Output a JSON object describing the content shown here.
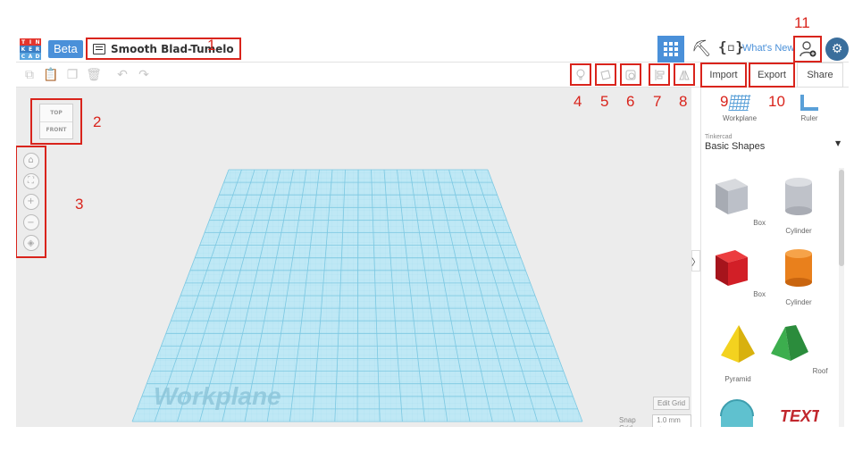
{
  "header": {
    "logo_letters": [
      "T",
      "I",
      "N",
      "K",
      "E",
      "R",
      "C",
      "A",
      "D"
    ],
    "logo_colors": [
      "#e3352d",
      "#e3352d",
      "#e3352d",
      "#3a7ec4",
      "#3a7ec4",
      "#3a7ec4",
      "#59a5e0",
      "#59a5e0",
      "#59a5e0"
    ],
    "beta_label": "Beta",
    "design_title": "Smooth Blad-Tumelo",
    "whats_new": "What's New"
  },
  "toolbar": {
    "import_label": "Import",
    "export_label": "Export",
    "share_label": "Share"
  },
  "viewcube": {
    "top_label": "TOP",
    "front_label": "FRONT"
  },
  "workplane_label": "Workplane",
  "grid": {
    "edit_grid_label": "Edit Grid",
    "snap_grid_label": "Snap Grid",
    "snap_grid_value": "1.0 mm ▲"
  },
  "sidebar": {
    "workplane_tool": "Workplane",
    "ruler_tool": "Ruler",
    "library_label": "Tinkercad",
    "category": "Basic Shapes",
    "shapes": [
      {
        "label": "Box",
        "color": "#b9bcc4"
      },
      {
        "label": "Cylinder",
        "color": "#c7cad1"
      },
      {
        "label": "Box",
        "color": "#d4202a"
      },
      {
        "label": "Cylinder",
        "color": "#e87b1a"
      },
      {
        "label": "Pyramid",
        "color": "#f1cf1d"
      },
      {
        "label": "Roof",
        "color": "#38a34a"
      },
      {
        "label": "",
        "color": "#5fc1cf"
      },
      {
        "label": "",
        "color": "#c1272d"
      }
    ]
  },
  "annotations": [
    "1",
    "2",
    "3",
    "4",
    "5",
    "6",
    "7",
    "8",
    "9",
    "10",
    "11"
  ],
  "colors": {
    "accent": "#4a90d9",
    "annotation_red": "#d9241c",
    "grid_blue": "#8dd0e8"
  }
}
